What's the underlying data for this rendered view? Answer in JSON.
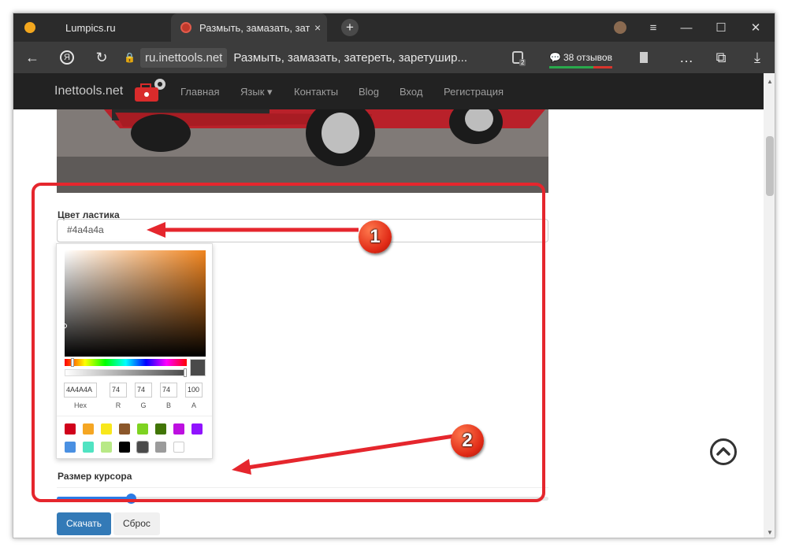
{
  "tabs": [
    {
      "label": "Lumpics.ru"
    },
    {
      "label": "Размыть, замазать, зате",
      "close": "×"
    }
  ],
  "window_controls": {
    "new_tab": "+"
  },
  "address_bar": {
    "host": "ru.inettools.net",
    "page_title": "Размыть, замазать, затереть, заретушир...",
    "badge_count": "2",
    "reviews": "38 отзывов"
  },
  "site": {
    "brand": "Inettools.net",
    "nav": [
      "Главная",
      "Язык ▾",
      "Контакты",
      "Blog",
      "Вход",
      "Регистрация"
    ]
  },
  "eraser": {
    "color_label": "Цвет ластика",
    "color_value": "#4a4a4a",
    "picker": {
      "hex": "4A4A4A",
      "r": "74",
      "g": "74",
      "b": "74",
      "a": "100",
      "labels": {
        "hex": "Hex",
        "r": "R",
        "g": "G",
        "b": "B",
        "a": "A"
      },
      "swatches": [
        "#d0021b",
        "#f5a623",
        "#f8e71c",
        "#8b572a",
        "#7ed321",
        "#417505",
        "#bd10e0",
        "#9013fe",
        "#4a90e2",
        "#50e3c2",
        "#b8e986",
        "#000000",
        "#4a4a4a",
        "#9b9b9b",
        "#ffffff"
      ]
    },
    "size_label": "Размер курсора",
    "size_value": 0.25
  },
  "buttons": {
    "download": "Скачать",
    "reset": "Сброс"
  },
  "annotations": {
    "one": "1",
    "two": "2"
  },
  "colors": {
    "annotation_red": "#e5262d",
    "accent": "#2c7be5"
  }
}
